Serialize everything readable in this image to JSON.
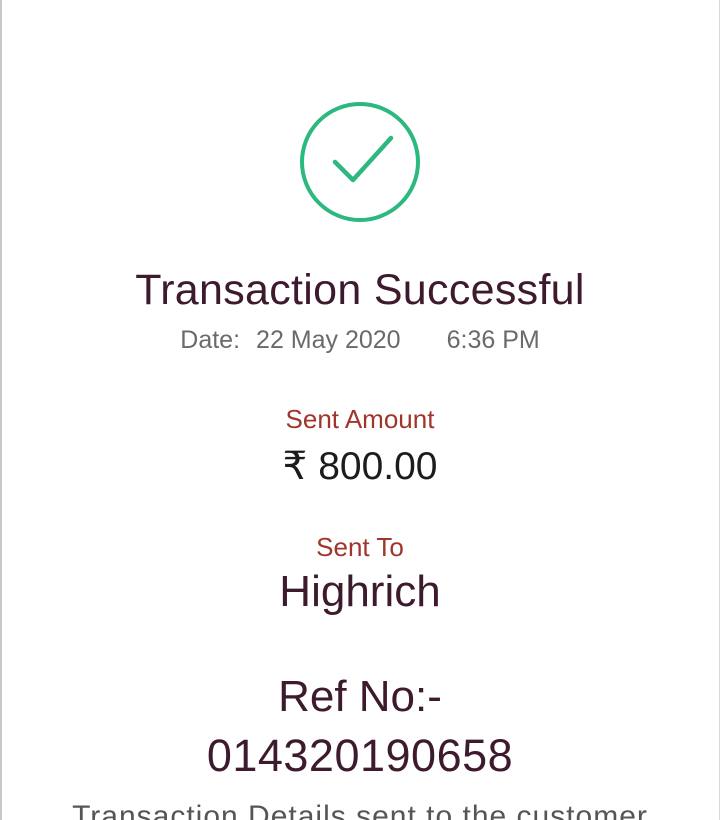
{
  "status": {
    "icon": "check-circle-icon",
    "color": "#2cb87e",
    "title": "Transaction Successful"
  },
  "date": {
    "label": "Date:",
    "value": "22 May 2020",
    "time": "6:36 PM"
  },
  "amount": {
    "label": "Sent Amount",
    "currency_symbol": "₹",
    "value": "800.00"
  },
  "recipient": {
    "label": "Sent To",
    "name": "Highrich"
  },
  "reference": {
    "label": "Ref No:-",
    "number": "014320190658"
  },
  "footer": {
    "note": "Transaction Details sent to the customer"
  }
}
